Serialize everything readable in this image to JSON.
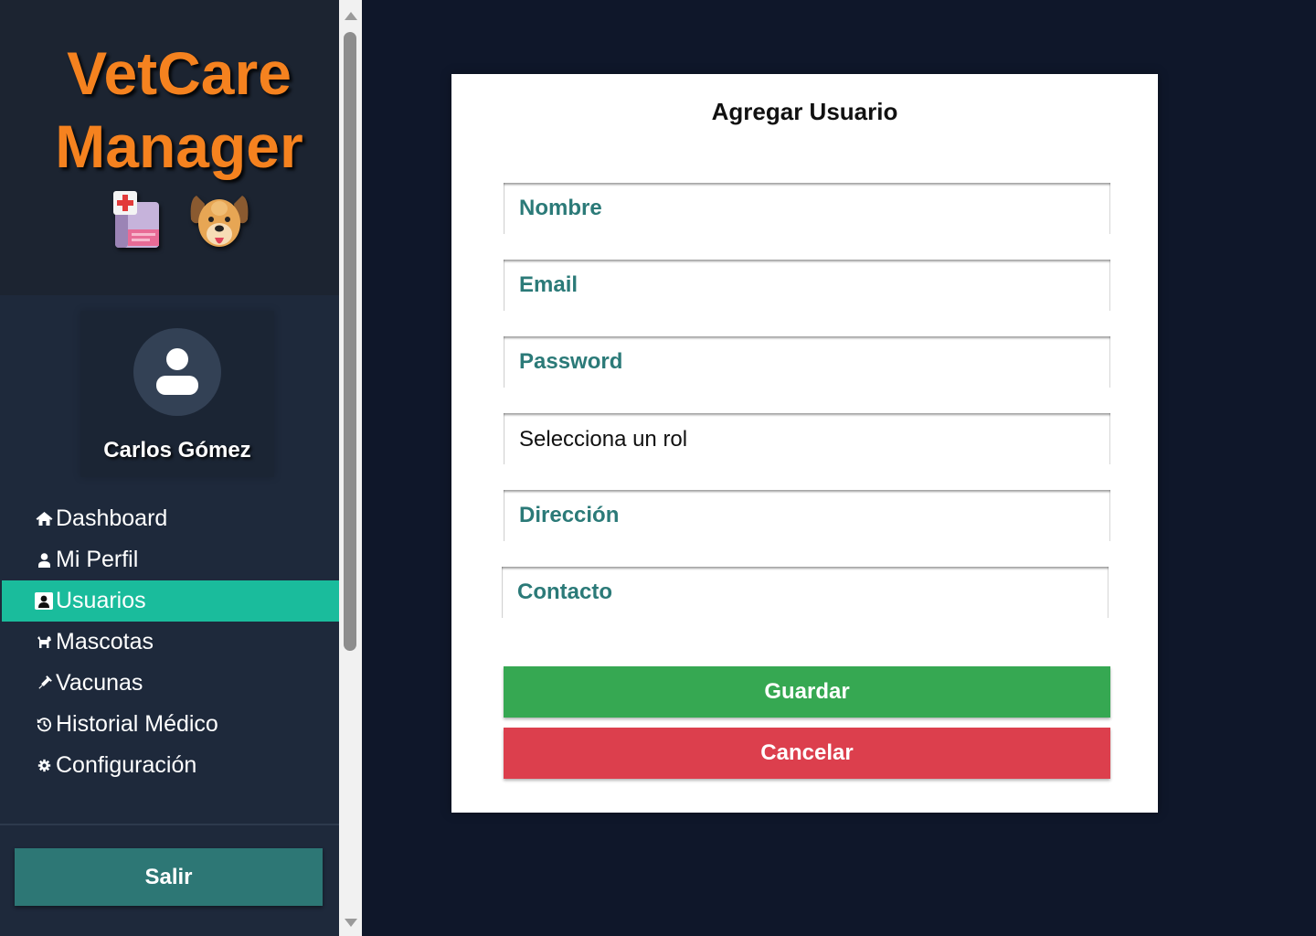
{
  "app": {
    "brand_line1": "VetCare",
    "brand_line2": "Manager",
    "logo_icons": [
      "medical-record-icon",
      "dog-face-icon"
    ]
  },
  "colors": {
    "brand": "#f5821f",
    "logo_bg": "#1c2431",
    "sidebar_bg": "#1e293b",
    "page_bg": "#0f172a",
    "active_nav": "#1abc9c",
    "logout_button": "#2d7775",
    "placeholder": "#2b7a78",
    "save_button": "#36a852",
    "cancel_button": "#dc3f4d"
  },
  "profile": {
    "name": "Carlos Gómez",
    "avatar_icon": "user-icon"
  },
  "sidebar": {
    "items": [
      {
        "label": "Dashboard",
        "icon": "home-icon"
      },
      {
        "label": "Mi Perfil",
        "icon": "user-icon"
      },
      {
        "label": "Usuarios",
        "icon": "id-badge-icon",
        "active": true
      },
      {
        "label": "Mascotas",
        "icon": "dog-icon"
      },
      {
        "label": "Vacunas",
        "icon": "syringe-icon"
      },
      {
        "label": "Historial Médico",
        "icon": "history-icon"
      },
      {
        "label": "Configuración",
        "icon": "gear-icon"
      }
    ],
    "logout_label": "Salir",
    "scrollbar": {
      "scroll_position": 0,
      "visible_fraction": 0.7
    }
  },
  "form": {
    "title": "Agregar Usuario",
    "fields": {
      "nombre": {
        "placeholder": "Nombre",
        "value": ""
      },
      "email": {
        "placeholder": "Email",
        "value": ""
      },
      "password": {
        "placeholder": "Password",
        "value": ""
      },
      "direccion": {
        "placeholder": "Dirección",
        "value": ""
      },
      "contacto": {
        "placeholder": "Contacto",
        "value": ""
      }
    },
    "role_select": {
      "selected": "Selecciona un rol"
    },
    "save_label": "Guardar",
    "cancel_label": "Cancelar"
  }
}
